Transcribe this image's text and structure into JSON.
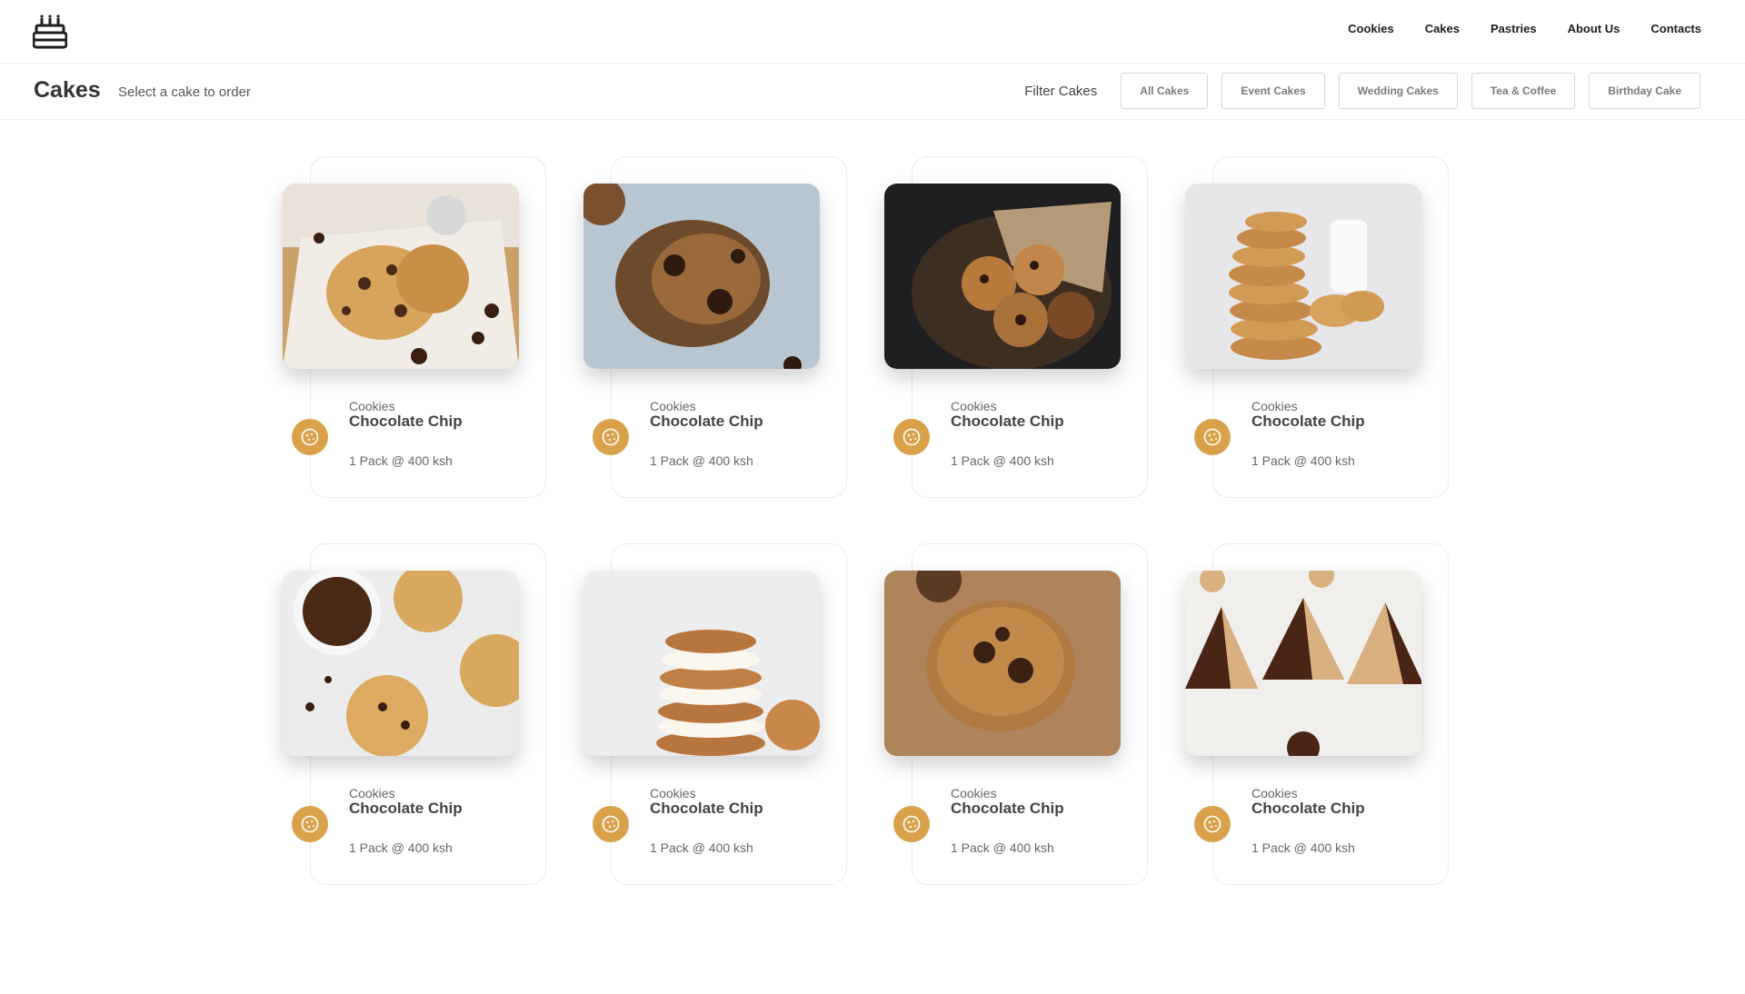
{
  "nav": {
    "items": [
      "Cookies",
      "Cakes",
      "Pastries",
      "About Us",
      "Contacts"
    ]
  },
  "header": {
    "title": "Cakes",
    "subtitle": "Select a cake to order",
    "filter_label": "Filter Cakes",
    "filters": [
      "All Cakes",
      "Event Cakes",
      "Wedding Cakes",
      "Tea & Coffee",
      "Birthday Cake"
    ]
  },
  "accent_color": "#d9a24a",
  "products": [
    {
      "category": "Cookies",
      "name": "Chocolate Chip",
      "price": "1 Pack @ 400 ksh",
      "image_icon": "cookie-photo"
    },
    {
      "category": "Cookies",
      "name": "Chocolate Chip",
      "price": "1 Pack @ 400 ksh",
      "image_icon": "cookie-photo"
    },
    {
      "category": "Cookies",
      "name": "Chocolate Chip",
      "price": "1 Pack @ 400 ksh",
      "image_icon": "cookie-photo"
    },
    {
      "category": "Cookies",
      "name": "Chocolate Chip",
      "price": "1 Pack @ 400 ksh",
      "image_icon": "cookie-photo"
    },
    {
      "category": "Cookies",
      "name": "Chocolate Chip",
      "price": "1 Pack @ 400 ksh",
      "image_icon": "cookie-photo"
    },
    {
      "category": "Cookies",
      "name": "Chocolate Chip",
      "price": "1 Pack @ 400 ksh",
      "image_icon": "cookie-photo"
    },
    {
      "category": "Cookies",
      "name": "Chocolate Chip",
      "price": "1 Pack @ 400 ksh",
      "image_icon": "cookie-photo"
    },
    {
      "category": "Cookies",
      "name": "Chocolate Chip",
      "price": "1 Pack @ 400 ksh",
      "image_icon": "gingerbread-tree-photo"
    }
  ]
}
